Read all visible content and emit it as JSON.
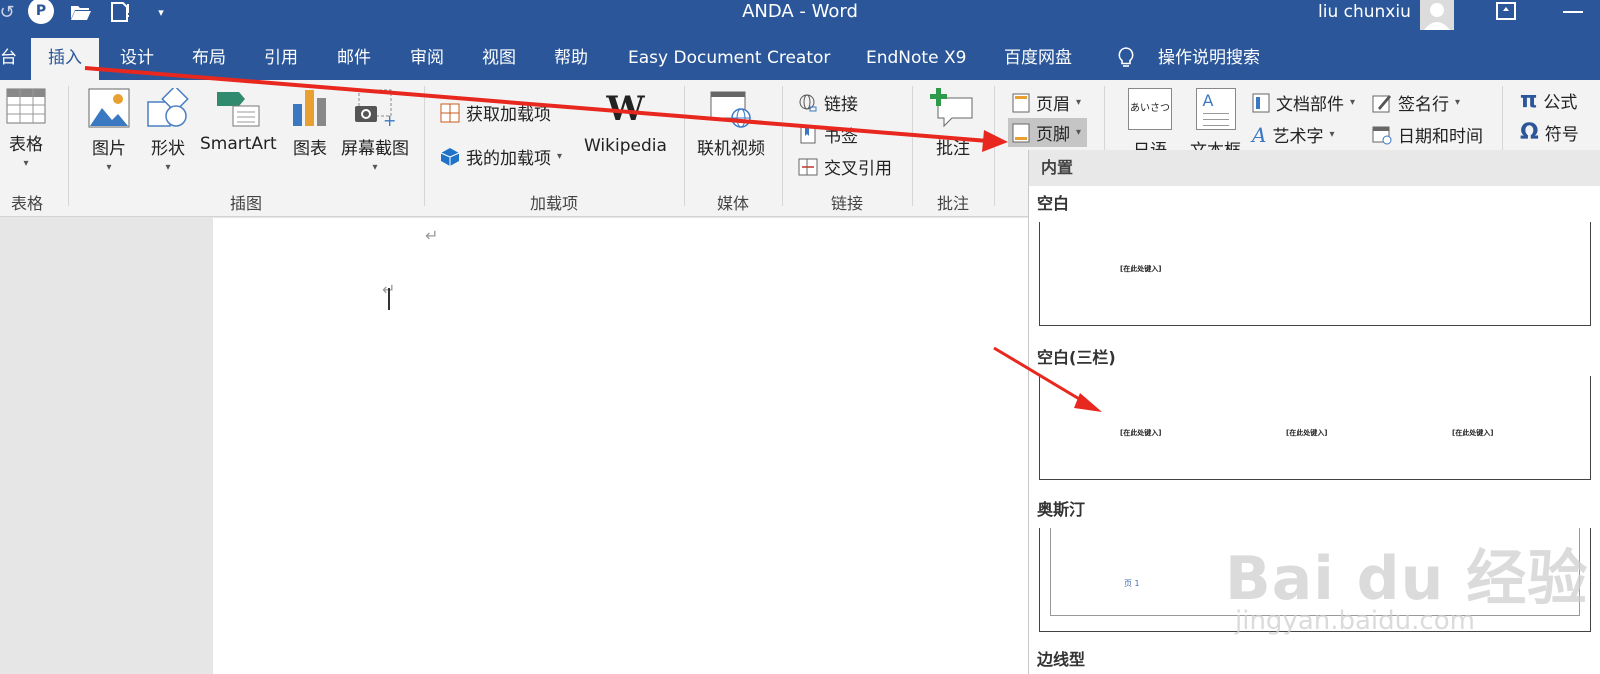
{
  "window": {
    "title": "ANDA  -  Word",
    "user": "liu chunxiu"
  },
  "quick_access": {
    "p_badge": "P",
    "icons": [
      "undo-icon",
      "p-icon",
      "open-folder-icon",
      "new-doc-icon",
      "customize-qat-icon"
    ]
  },
  "tabs": [
    {
      "label": "台"
    },
    {
      "label": "插入",
      "active": true
    },
    {
      "label": "设计"
    },
    {
      "label": "布局"
    },
    {
      "label": "引用"
    },
    {
      "label": "邮件"
    },
    {
      "label": "审阅"
    },
    {
      "label": "视图"
    },
    {
      "label": "帮助"
    },
    {
      "label": "Easy Document Creator"
    },
    {
      "label": "EndNote X9"
    },
    {
      "label": "百度网盘"
    },
    {
      "label": "操作说明搜索"
    }
  ],
  "ribbon": {
    "tables": {
      "group": "表格",
      "button": "表格"
    },
    "illustrations": {
      "group": "插图",
      "picture": "图片",
      "shapes": "形状",
      "smartart": "SmartArt",
      "chart": "图表",
      "screenshot": "屏幕截图"
    },
    "addins": {
      "group": "加载项",
      "get": "获取加载项",
      "mine": "我的加载项",
      "wikipedia": "Wikipedia",
      "wiki_glyph": "W"
    },
    "media": {
      "group": "媒体",
      "online_video": "联机视频"
    },
    "links": {
      "group": "链接",
      "link": "链接",
      "bookmark": "书签",
      "cross_ref": "交叉引用"
    },
    "comments": {
      "group": "批注",
      "comment": "批注"
    },
    "header_footer": {
      "header": "页眉",
      "footer": "页脚"
    },
    "text": {
      "japanese": "日语",
      "textbox": "文本框",
      "textbox_icon": "A",
      "kana": "あいさつ",
      "quick_parts": "文档部件",
      "wordart": "艺术字",
      "signature": "签名行",
      "datetime": "日期和时间"
    },
    "symbols": {
      "equation": "公式",
      "equation_glyph": "π",
      "symbol": "符号",
      "symbol_glyph": "Ω"
    }
  },
  "gallery": {
    "header": "内置",
    "items": [
      {
        "title": "空白",
        "texts": [
          "[在此处键入]"
        ]
      },
      {
        "title": "空白(三栏)",
        "texts": [
          "[在此处键入]",
          "[在此处键入]",
          "[在此处键入]"
        ]
      },
      {
        "title": "奥斯汀",
        "texts": [
          "页 1"
        ]
      },
      {
        "title": "边线型",
        "texts": []
      }
    ]
  },
  "document": {
    "pilcrow": "↵"
  },
  "watermark": {
    "main": "Bai du 经验",
    "sub": "jingyan.baidu.com"
  },
  "colors": {
    "accent": "#2b579a",
    "arrow": "#e8281e",
    "ribbon_bg": "#f3f3f3"
  }
}
